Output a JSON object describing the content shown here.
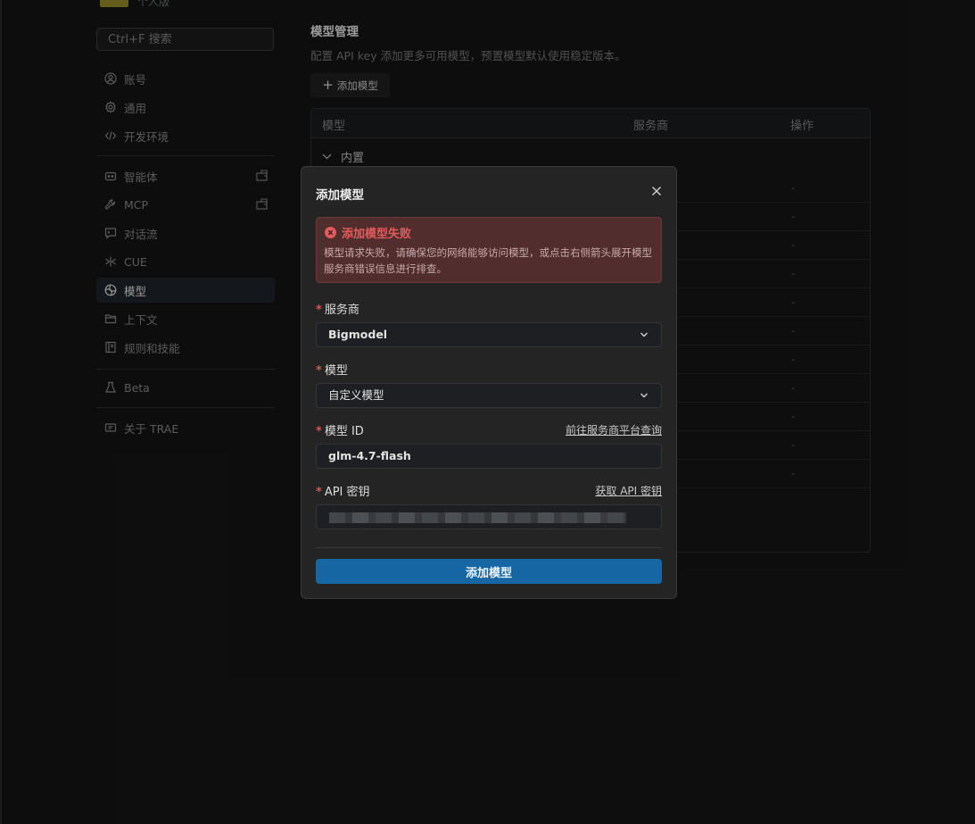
{
  "sidebar": {
    "plan_label": "个人版",
    "search_placeholder": "Ctrl+F 搜索",
    "items": [
      {
        "label": "账号",
        "icon": "user-icon"
      },
      {
        "label": "通用",
        "icon": "gear-icon"
      },
      {
        "label": "开发环境",
        "icon": "code-icon"
      },
      {
        "label": "智能体",
        "icon": "bot-icon"
      },
      {
        "label": "MCP",
        "icon": "wrench-icon"
      },
      {
        "label": "对话流",
        "icon": "chat-icon"
      },
      {
        "label": "CUE",
        "icon": "cue-icon"
      },
      {
        "label": "模型",
        "icon": "model-icon"
      },
      {
        "label": "上下文",
        "icon": "folder-icon"
      },
      {
        "label": "规则和技能",
        "icon": "book-icon"
      },
      {
        "label": "Beta",
        "icon": "flask-icon"
      },
      {
        "label": "关于 TRAE",
        "icon": "info-card-icon"
      }
    ],
    "active_item": "模型"
  },
  "main": {
    "title": "模型管理",
    "description": "配置 API key 添加更多可用模型，预置模型默认使用稳定版本。",
    "add_button_label": "添加模型",
    "table": {
      "columns": [
        "模型",
        "服务商",
        "操作"
      ],
      "group_label": "内置",
      "row_placeholder": "-"
    }
  },
  "modal": {
    "title": "添加模型",
    "alert": {
      "title": "添加模型失败",
      "message": "模型请求失败，请确保您的网络能够访问模型，或点击右侧箭头展开模型服务商错误信息进行排查。"
    },
    "provider": {
      "label": "服务商",
      "value": "Bigmodel"
    },
    "model": {
      "label": "模型",
      "value": "自定义模型"
    },
    "model_id": {
      "label": "模型 ID",
      "link": "前往服务商平台查询",
      "value": "glm-4.7-flash"
    },
    "api_key": {
      "label": "API 密钥",
      "link": "获取 API 密钥",
      "value": "••••••••••••••••••••••••••••••••"
    },
    "submit_label": "添加模型"
  },
  "colors": {
    "accent": "#1666a3",
    "error": "#e35c5c",
    "error_bg": "#512d2d",
    "required": "#e05050"
  }
}
